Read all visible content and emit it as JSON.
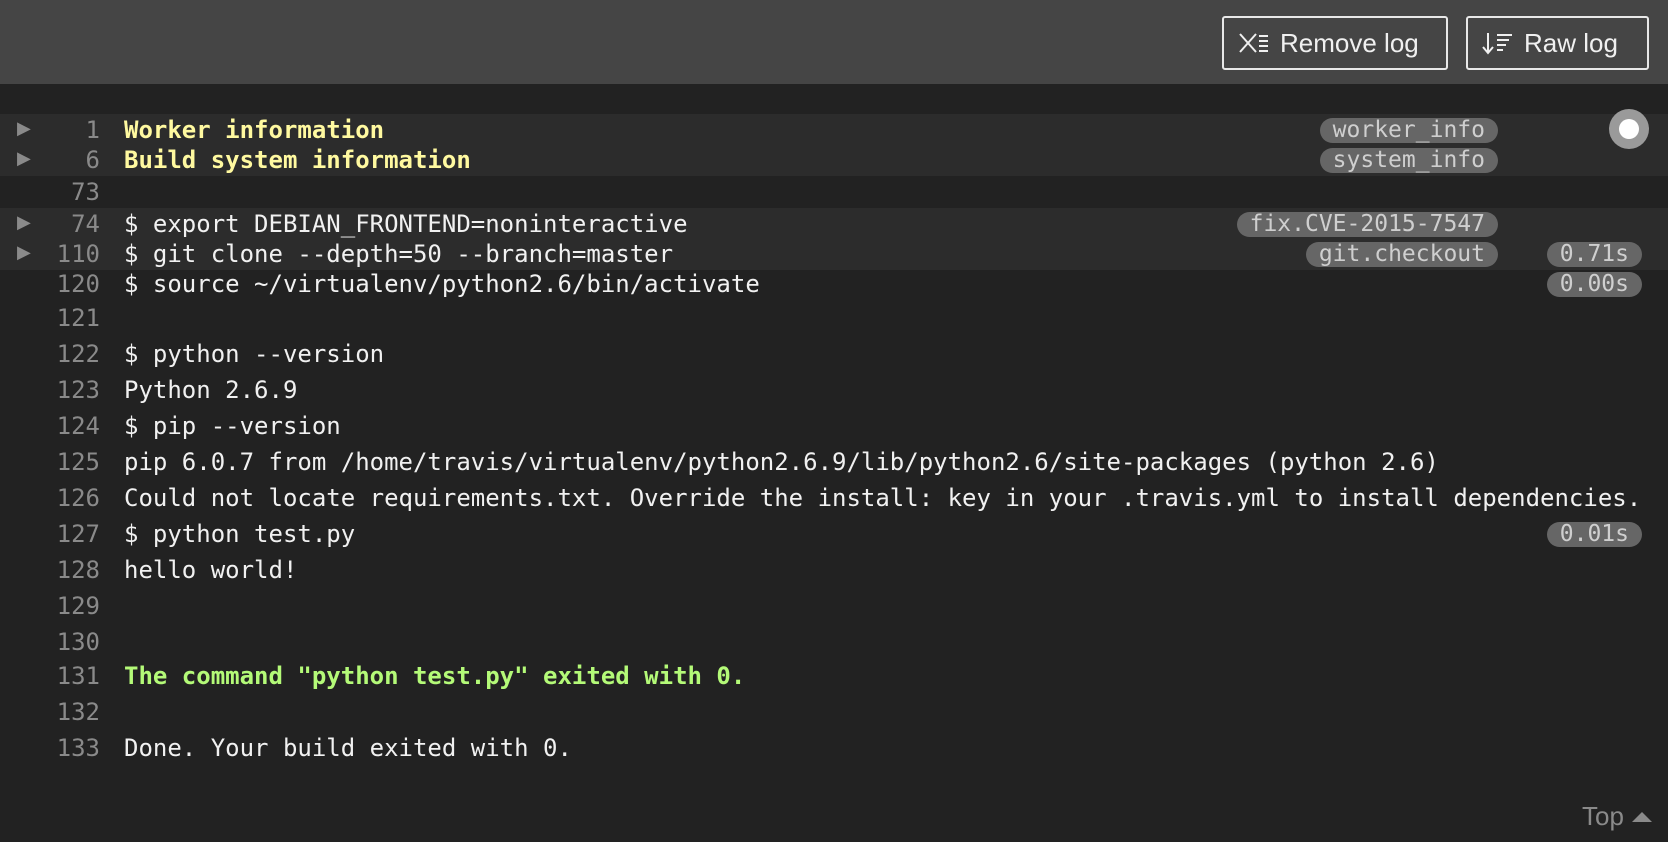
{
  "toolbar": {
    "remove_label": "Remove log",
    "raw_label": "Raw log",
    "remove_icon": "remove-log-icon",
    "raw_icon": "raw-log-icon"
  },
  "lines": [
    {
      "num": "1",
      "text": "Worker information",
      "style": "yellow",
      "fold": true,
      "tag": "worker_info",
      "time": ""
    },
    {
      "num": "6",
      "text": "Build system information",
      "style": "yellow",
      "fold": true,
      "tag": "system_info",
      "time": ""
    },
    {
      "num": "73",
      "text": "",
      "style": "",
      "fold": false,
      "tag": "",
      "time": ""
    },
    {
      "num": "74",
      "text": "$ export DEBIAN_FRONTEND=noninteractive",
      "style": "",
      "fold": true,
      "tag": "fix.CVE-2015-7547",
      "time": ""
    },
    {
      "num": "110",
      "text": "$ git clone --depth=50 --branch=master",
      "style": "",
      "fold": true,
      "tag": "git.checkout",
      "time": "0.71s"
    },
    {
      "num": "120",
      "text": "$ source ~/virtualenv/python2.6/bin/activate",
      "style": "",
      "fold": false,
      "tag": "",
      "time": "0.00s"
    },
    {
      "num": "121",
      "text": "",
      "style": "",
      "fold": false,
      "tag": "",
      "time": ""
    },
    {
      "num": "122",
      "text": "$ python --version",
      "style": "",
      "fold": false,
      "tag": "",
      "time": ""
    },
    {
      "num": "123",
      "text": "Python 2.6.9",
      "style": "",
      "fold": false,
      "tag": "",
      "time": ""
    },
    {
      "num": "124",
      "text": "$ pip --version",
      "style": "",
      "fold": false,
      "tag": "",
      "time": ""
    },
    {
      "num": "125",
      "text": "pip 6.0.7 from /home/travis/virtualenv/python2.6.9/lib/python2.6/site-packages (python 2.6)",
      "style": "",
      "fold": false,
      "tag": "",
      "time": ""
    },
    {
      "num": "126",
      "text": "Could not locate requirements.txt. Override the install: key in your .travis.yml to install dependencies.",
      "style": "",
      "fold": false,
      "tag": "",
      "time": ""
    },
    {
      "num": "127",
      "text": "$ python test.py",
      "style": "",
      "fold": false,
      "tag": "",
      "time": "0.01s"
    },
    {
      "num": "128",
      "text": "hello world!",
      "style": "",
      "fold": false,
      "tag": "",
      "time": ""
    },
    {
      "num": "129",
      "text": "",
      "style": "",
      "fold": false,
      "tag": "",
      "time": ""
    },
    {
      "num": "130",
      "text": "",
      "style": "",
      "fold": false,
      "tag": "",
      "time": ""
    },
    {
      "num": "131",
      "text": "The command \"python test.py\" exited with 0.",
      "style": "green",
      "fold": false,
      "tag": "",
      "time": ""
    },
    {
      "num": "132",
      "text": "",
      "style": "",
      "fold": false,
      "tag": "",
      "time": ""
    },
    {
      "num": "133",
      "text": "Done. Your build exited with 0.",
      "style": "",
      "fold": false,
      "tag": "",
      "time": ""
    }
  ],
  "fold_arrow": "▶",
  "top_link": {
    "label": "Top",
    "icon": "arrow-up-icon"
  },
  "record_icon": "record-icon",
  "colors": {
    "background": "#222222",
    "toolbar": "#454545",
    "fold_row": "#2c2c2c",
    "header_text": "#fff9a0",
    "success_text": "#b4fa78",
    "tag_bg": "#666666"
  }
}
